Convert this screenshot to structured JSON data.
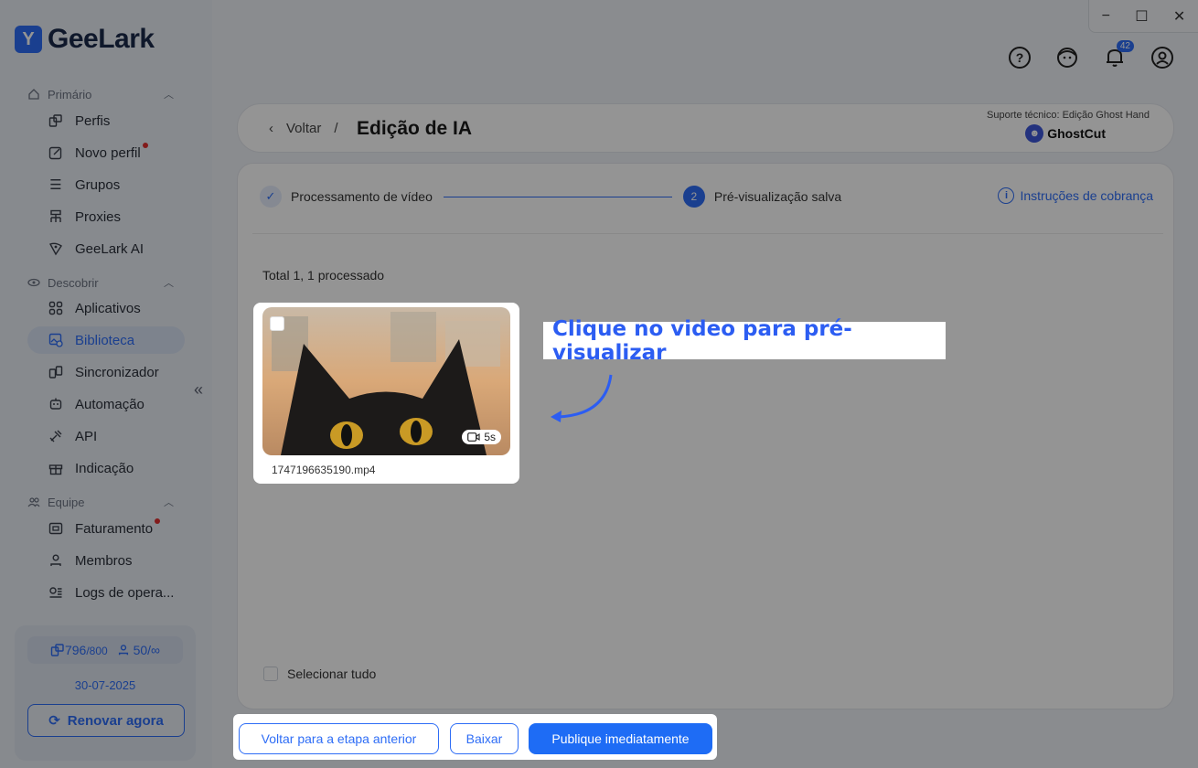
{
  "app": {
    "logo_text": "GeeLark",
    "logo_mark": "Y"
  },
  "sidebar": {
    "sections": [
      {
        "title": "Primário",
        "icon": "home-icon"
      },
      {
        "title": "Descobrir",
        "icon": "eye-icon"
      },
      {
        "title": "Equipe",
        "icon": "team-icon"
      }
    ],
    "items": [
      {
        "label": "Perfis",
        "icon": "profiles-icon"
      },
      {
        "label": "Novo perfil",
        "icon": "edit-icon",
        "dot": true
      },
      {
        "label": "Grupos",
        "icon": "list-icon"
      },
      {
        "label": "Proxies",
        "icon": "proxy-icon"
      },
      {
        "label": "GeeLark AI",
        "icon": "ai-icon"
      },
      {
        "label": "Aplicativos",
        "icon": "grid-icon"
      },
      {
        "label": "Biblioteca",
        "icon": "library-icon",
        "active": true
      },
      {
        "label": "Sincronizador",
        "icon": "sync-icon"
      },
      {
        "label": "Automação",
        "icon": "robot-icon"
      },
      {
        "label": "API",
        "icon": "api-icon"
      },
      {
        "label": "Indicação",
        "icon": "gift-icon"
      },
      {
        "label": "Faturamento",
        "icon": "wallet-icon",
        "dot": true
      },
      {
        "label": "Membros",
        "icon": "user-icon"
      },
      {
        "label": "Logs de opera...",
        "icon": "logs-icon"
      }
    ],
    "plan": {
      "profiles_used": "796",
      "profiles_total": "/800",
      "members_used": "50",
      "members_total": "/∞",
      "date": "30-07-2025",
      "renew_label": "Renovar agora"
    }
  },
  "topbar": {
    "notifications_count": "42"
  },
  "header": {
    "back_label": "Voltar",
    "separator": "/",
    "title": "Edição de IA",
    "support_text": "Suporte técnico: Edição Ghost Hand",
    "partner": "GhostCut"
  },
  "steps": [
    {
      "label": "Processamento de vídeo",
      "state": "done"
    },
    {
      "label": "Pré-visualização salva",
      "state": "current",
      "number": "2"
    }
  ],
  "billing_label": "Instruções de cobrança",
  "total_text": "Total 1, 1 processado",
  "video": {
    "duration": "5s",
    "filename": "1747196635190.mp4"
  },
  "select_all_label": "Selecionar tudo",
  "actions": {
    "back_step": "Voltar para a etapa anterior",
    "download": "Baixar",
    "publish": "Publique imediatamente"
  },
  "hint_text": "Clique no video para pré-visualizar",
  "colors": {
    "accent": "#2e6df6",
    "primary_button": "#1e6cf5",
    "hint_text": "#2c5df2"
  }
}
